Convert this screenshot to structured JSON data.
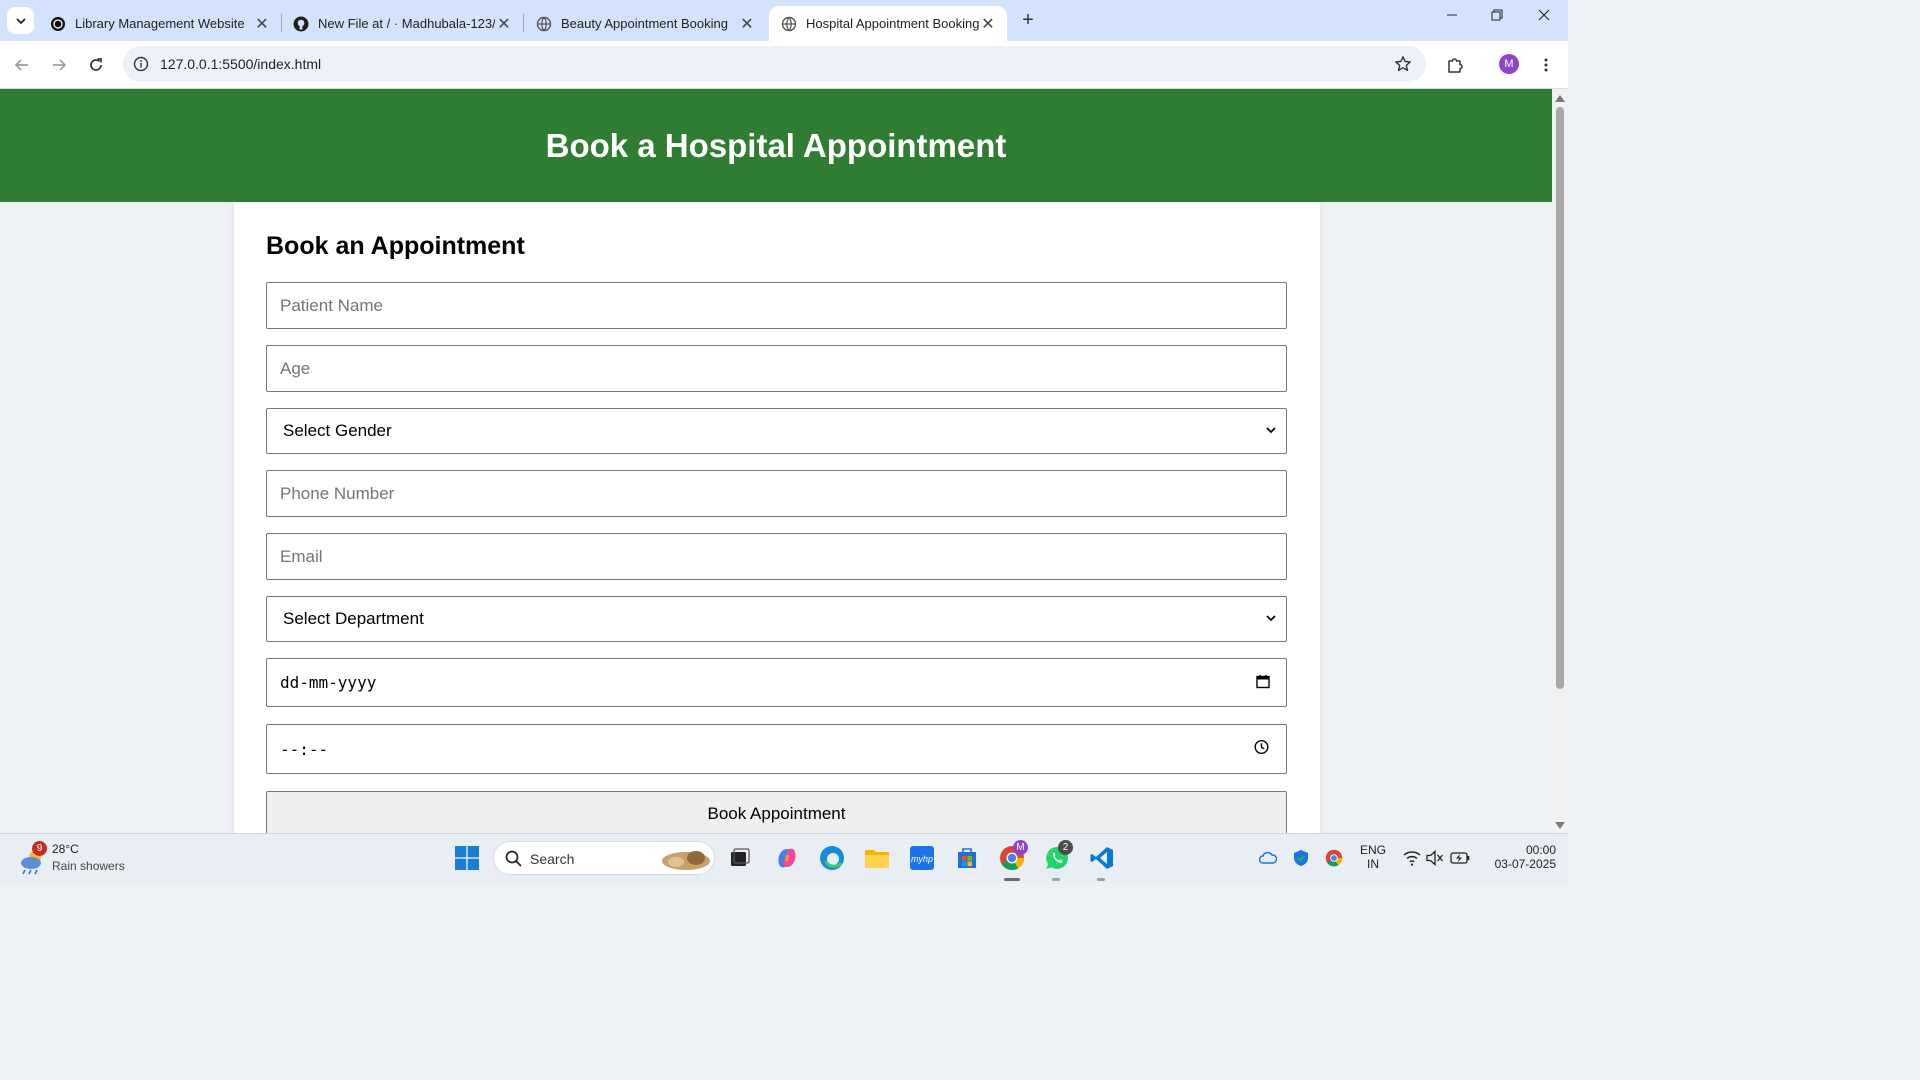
{
  "browser": {
    "tabs": [
      {
        "title": "Library Management Website",
        "icon": "openai-icon",
        "active": false
      },
      {
        "title": "New File at / · Madhubala-123/",
        "icon": "github-icon",
        "active": false
      },
      {
        "title": "Beauty Appointment Booking",
        "icon": "globe-icon",
        "active": false
      },
      {
        "title": "Hospital Appointment Booking",
        "icon": "globe-icon",
        "active": true
      }
    ],
    "url": "127.0.0.1:5500/index.html",
    "profile_initial": "M"
  },
  "page": {
    "header_title": "Book a Hospital Appointment",
    "form": {
      "title": "Book an Appointment",
      "patient_name_placeholder": "Patient Name",
      "age_placeholder": "Age",
      "gender_selected": "Select Gender",
      "phone_placeholder": "Phone Number",
      "email_placeholder": "Email",
      "department_selected": "Select Department",
      "date_value": "dd-mm-yyyy",
      "time_value": "--:--",
      "submit_label": "Book Appointment"
    }
  },
  "taskbar": {
    "weather": {
      "badge": "9",
      "temperature": "28°C",
      "condition": "Rain showers"
    },
    "search_label": "Search",
    "whatsapp_badge": "2",
    "chrome_badge": "M",
    "language": "ENG",
    "region": "IN",
    "time": "00:00",
    "date": "03-07-2025"
  }
}
